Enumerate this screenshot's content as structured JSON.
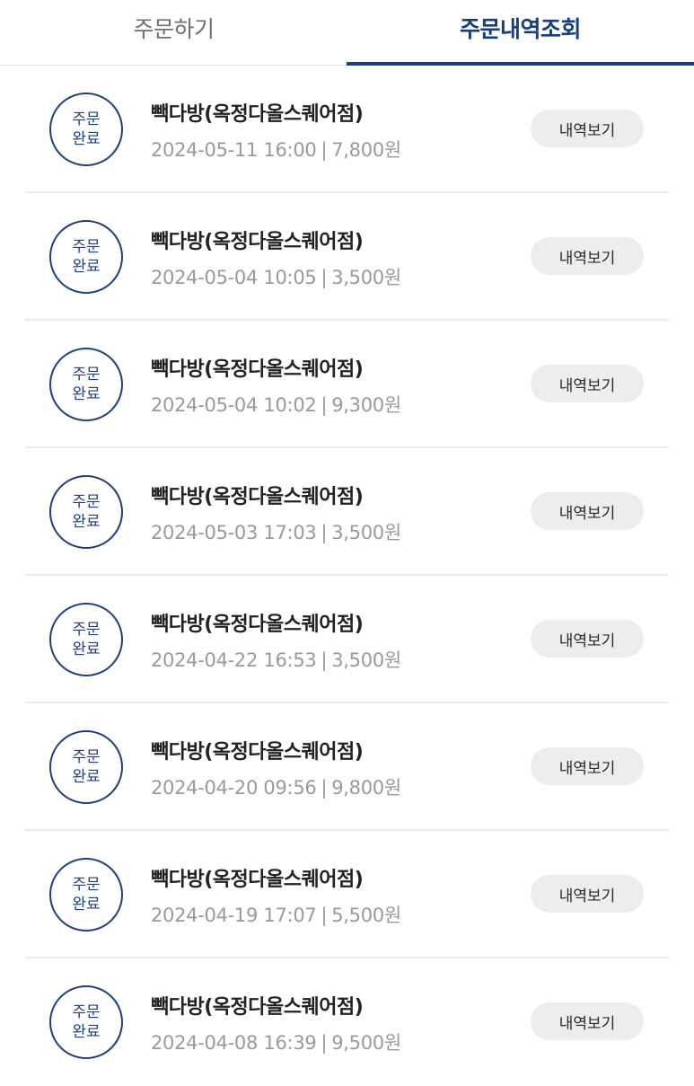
{
  "tabs": {
    "order": "주문하기",
    "history": "주문내역조회",
    "active": "history"
  },
  "colors": {
    "accent": "#173f80",
    "badge": "#1d4080",
    "button_bg": "#ededed",
    "meta_text": "#9a9a9a"
  },
  "orders": [
    {
      "status_line1": "주문",
      "status_line2": "완료",
      "store": "빽다방(옥정다올스퀘어점)",
      "datetime": "2024-05-11 16:00",
      "separator": "|",
      "amount": "7,800원",
      "button": "내역보기"
    },
    {
      "status_line1": "주문",
      "status_line2": "완료",
      "store": "빽다방(옥정다올스퀘어점)",
      "datetime": "2024-05-04 10:05",
      "separator": "|",
      "amount": "3,500원",
      "button": "내역보기"
    },
    {
      "status_line1": "주문",
      "status_line2": "완료",
      "store": "빽다방(옥정다올스퀘어점)",
      "datetime": "2024-05-04 10:02",
      "separator": "|",
      "amount": "9,300원",
      "button": "내역보기"
    },
    {
      "status_line1": "주문",
      "status_line2": "완료",
      "store": "빽다방(옥정다올스퀘어점)",
      "datetime": "2024-05-03 17:03",
      "separator": "|",
      "amount": "3,500원",
      "button": "내역보기"
    },
    {
      "status_line1": "주문",
      "status_line2": "완료",
      "store": "빽다방(옥정다올스퀘어점)",
      "datetime": "2024-04-22 16:53",
      "separator": "|",
      "amount": "3,500원",
      "button": "내역보기"
    },
    {
      "status_line1": "주문",
      "status_line2": "완료",
      "store": "빽다방(옥정다올스퀘어점)",
      "datetime": "2024-04-20 09:56",
      "separator": "|",
      "amount": "9,800원",
      "button": "내역보기"
    },
    {
      "status_line1": "주문",
      "status_line2": "완료",
      "store": "빽다방(옥정다올스퀘어점)",
      "datetime": "2024-04-19 17:07",
      "separator": "|",
      "amount": "5,500원",
      "button": "내역보기"
    },
    {
      "status_line1": "주문",
      "status_line2": "완료",
      "store": "빽다방(옥정다올스퀘어점)",
      "datetime": "2024-04-08 16:39",
      "separator": "|",
      "amount": "9,500원",
      "button": "내역보기"
    }
  ]
}
